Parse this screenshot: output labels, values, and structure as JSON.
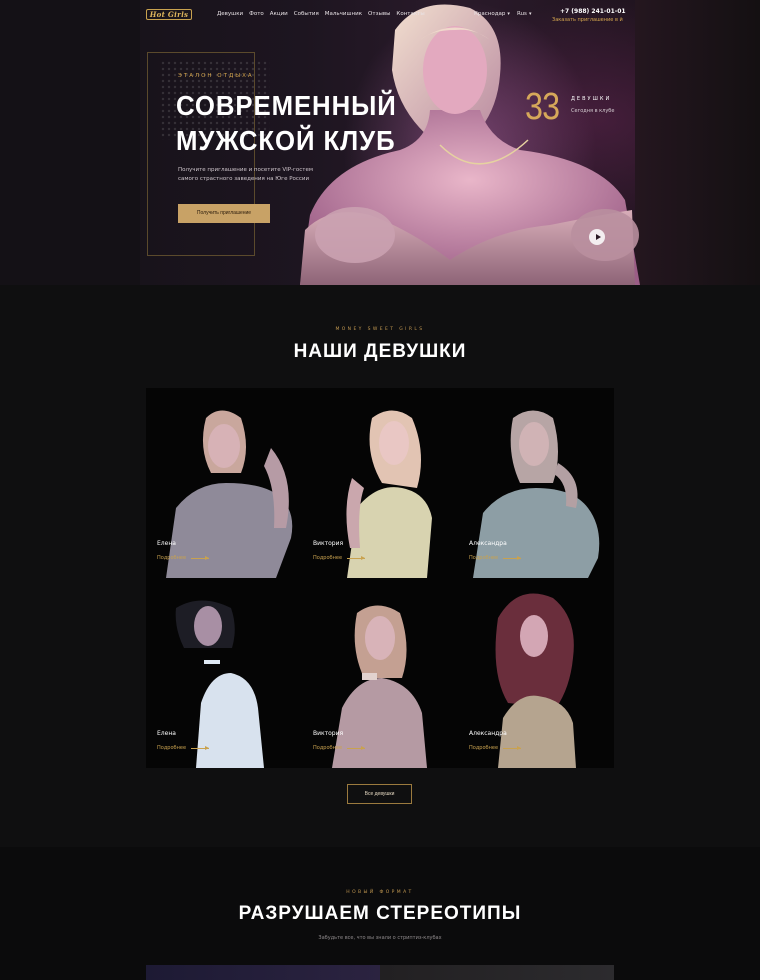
{
  "header": {
    "logo_text": "Hot Girls",
    "nav": [
      "Девушки",
      "Фото",
      "Акции",
      "События",
      "Мальчишник",
      "Отзывы",
      "Контакты"
    ],
    "city": "Краснодар",
    "lang": "Rus",
    "phone": "+7 (988) 241-01-01",
    "phone_sub": "Заказать приглашение в й"
  },
  "hero": {
    "kicker": "ЭТАЛОН ОТДЫХА",
    "title_line1": "СОВРЕМЕННЫЙ",
    "title_line2": "МУЖСКОЙ КЛУБ",
    "description": "Получите приглашение и посетите VIP-гостем самого страстного заведения на Юге России",
    "cta_label": "Получить приглашение",
    "stat_number": "33",
    "stat_label": "ДЕВУШКИ",
    "stat_sub": "Сегодня в клубе"
  },
  "girls": {
    "kicker": "MONEY SWEET GIRLS",
    "title": "НАШИ ДЕВУШКИ",
    "cards": [
      {
        "name": "Елена",
        "link": "Подробнее"
      },
      {
        "name": "Виктория",
        "link": "Подробнее"
      },
      {
        "name": "Александра",
        "link": "Подробнее"
      },
      {
        "name": "Елена",
        "link": "Подробнее"
      },
      {
        "name": "Виктория",
        "link": "Подробнее"
      },
      {
        "name": "Александра",
        "link": "Подробнее"
      }
    ],
    "all_label": "Все девушки"
  },
  "stereotypes": {
    "kicker": "НОВЫЙ ФОРМАТ",
    "title": "РАЗРУШАЕМ СТЕРЕОТИПЫ",
    "subtitle": "Забудьте все, что вы знали о стриптиз-клубах"
  },
  "colors": {
    "accent": "#c9a24f",
    "background": "#0f0f10"
  }
}
